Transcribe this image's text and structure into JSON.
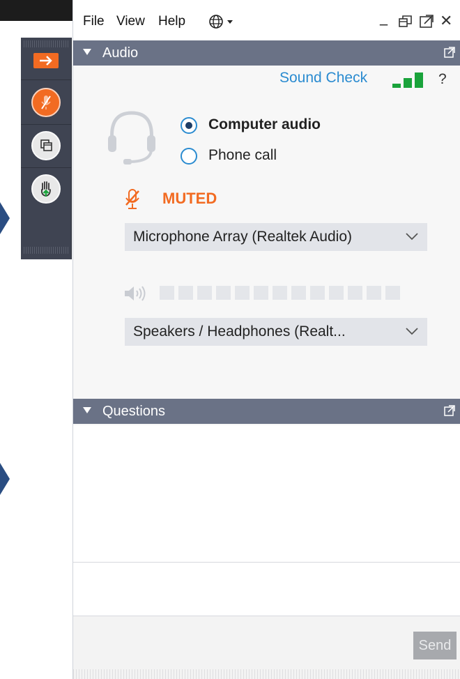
{
  "menu": {
    "file": "File",
    "view": "View",
    "help": "Help",
    "globe_icon": "globe-icon",
    "window_controls": {
      "minimize": "_",
      "restore_icon": "restore-icon",
      "popout_icon": "popout-icon",
      "close": "✕"
    }
  },
  "toolbar": {
    "items": [
      {
        "icon": "arrow-right-icon",
        "color": "#f26b22"
      },
      {
        "icon": "microphone-muted-icon",
        "color": "#f26b22"
      },
      {
        "icon": "screen-share-icon",
        "color": "#e6e6e6"
      },
      {
        "icon": "raise-hand-icon",
        "color": "#e6e6e6"
      }
    ]
  },
  "audio": {
    "section_title": "Audio",
    "sound_check_label": "Sound Check",
    "help_label": "?",
    "radio_options": [
      {
        "label": "Computer audio",
        "selected": true
      },
      {
        "label": "Phone call",
        "selected": false
      }
    ],
    "mute_status": "MUTED",
    "microphone_device": "Microphone Array (Realtek Audio)",
    "speaker_device": "Speakers / Headphones (Realt...",
    "speaker_level_segments": 13,
    "colors": {
      "accent_orange": "#f26b22",
      "link_blue": "#2a8bd0",
      "signal_green": "#1aa33b"
    }
  },
  "questions": {
    "section_title": "Questions",
    "send_label": "Send"
  }
}
